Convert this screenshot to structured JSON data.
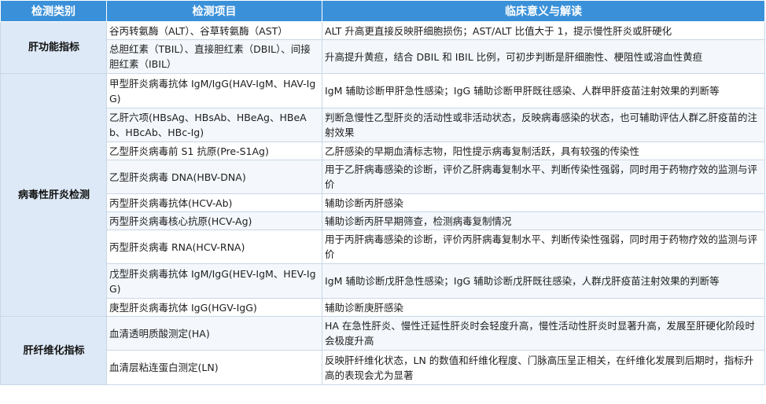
{
  "table": {
    "headers": [
      "检测类别",
      "检测项目",
      "临床意义与解读"
    ],
    "groups": [
      {
        "category": "肝功能指标",
        "rows": [
          {
            "item": "谷丙转氨酶（ALT）、谷草转氨酶（AST）",
            "meaning": "ALT 升高更直接反映肝细胞损伤；AST/ALT 比值大于 1，提示慢性肝炎或肝硬化"
          },
          {
            "item": "总胆红素（TBIL）、直接胆红素（DBIL）、间接胆红素（IBIL）",
            "meaning": "升高提升黄疸，结合 DBIL 和 IBIL 比例，可初步判断是肝细胞性、梗阻性或溶血性黄疸"
          }
        ]
      },
      {
        "category": "病毒性肝炎检测",
        "rows": [
          {
            "item": "甲型肝炎病毒抗体 IgM/IgG(HAV-IgM、HAV-IgG)",
            "meaning": "IgM 辅助诊断甲肝急性感染；IgG 辅助诊断甲肝既往感染、人群甲肝疫苗注射效果的判断等"
          },
          {
            "item": "乙肝六项(HBsAg、HBsAb、HBeAg、HBeAb、HBcAb、HBc-Ig)",
            "meaning": "判断急慢性乙型肝炎的活动性或非活动状态，反映病毒感染的状态，也可辅助评估人群乙肝疫苗的注射效果"
          },
          {
            "item": "乙型肝炎病毒前 S1 抗原(Pre-S1Ag)",
            "meaning": "乙肝感染的早期血清标志物，阳性提示病毒复制活跃，具有较强的传染性"
          },
          {
            "item": "乙型肝炎病毒 DNA(HBV-DNA)",
            "meaning": "用于乙肝病毒感染的诊断，评价乙肝病毒复制水平、判断传染性强弱，同时用于药物疗效的监测与评价"
          },
          {
            "item": "丙型肝炎病毒抗体(HCV-Ab)",
            "meaning": "辅助诊断丙肝感染"
          },
          {
            "item": "丙型肝炎病毒核心抗原(HCV-Ag)",
            "meaning": "辅助诊断丙肝早期筛查，检测病毒复制情况"
          },
          {
            "item": "丙型肝炎病毒 RNA(HCV-RNA)",
            "meaning": "用于丙肝病毒感染的诊断，评价丙肝病毒复制水平、判断传染性强弱，同时用于药物疗效的监测与评价"
          },
          {
            "item": "戊型肝炎病毒抗体 IgM/IgG(HEV-IgM、HEV-IgG)",
            "meaning": "IgM 辅助诊断戊肝急性感染；IgG 辅助诊断戊肝既往感染，人群戊肝疫苗注射效果的判断等"
          },
          {
            "item": "庚型肝炎病毒抗体 IgG(HGV-IgG)",
            "meaning": "辅助诊断庚肝感染"
          }
        ]
      },
      {
        "category": "肝纤维化指标",
        "rows": [
          {
            "item": "血清透明质酸测定(HA)",
            "meaning": "HA 在急性肝炎、慢性迁延性肝炎时会轻度升高，慢性活动性肝炎时显著升高，发展至肝硬化阶段时会极度升高"
          },
          {
            "item": "血清层粘连蛋白测定(LN)",
            "meaning": "反映肝纤维化状态，LN 的数值和纤维化程度、门脉高压呈正相关，在纤维化发展到后期时，指标升高的表现会尤为显著"
          }
        ]
      }
    ]
  }
}
